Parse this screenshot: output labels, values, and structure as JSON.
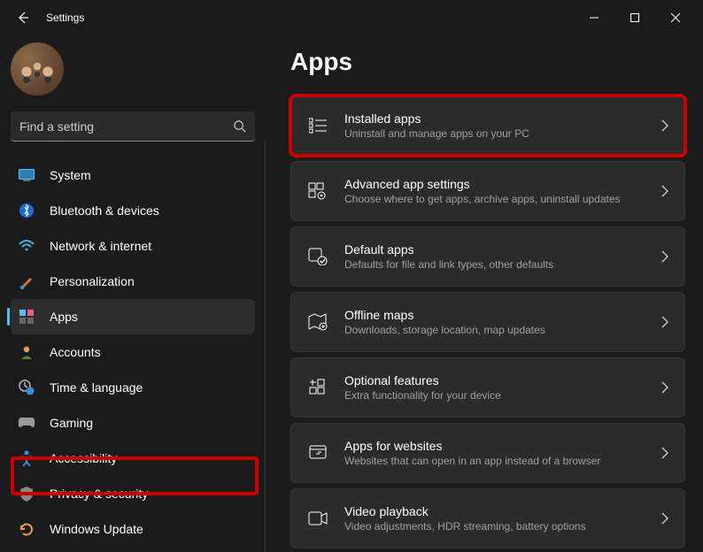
{
  "window": {
    "title": "Settings"
  },
  "search": {
    "placeholder": "Find a setting"
  },
  "sidebar": {
    "items": [
      {
        "label": "System"
      },
      {
        "label": "Bluetooth & devices"
      },
      {
        "label": "Network & internet"
      },
      {
        "label": "Personalization"
      },
      {
        "label": "Apps"
      },
      {
        "label": "Accounts"
      },
      {
        "label": "Time & language"
      },
      {
        "label": "Gaming"
      },
      {
        "label": "Accessibility"
      },
      {
        "label": "Privacy & security"
      },
      {
        "label": "Windows Update"
      }
    ]
  },
  "main": {
    "heading": "Apps",
    "cards": [
      {
        "title": "Installed apps",
        "sub": "Uninstall and manage apps on your PC"
      },
      {
        "title": "Advanced app settings",
        "sub": "Choose where to get apps, archive apps, uninstall updates"
      },
      {
        "title": "Default apps",
        "sub": "Defaults for file and link types, other defaults"
      },
      {
        "title": "Offline maps",
        "sub": "Downloads, storage location, map updates"
      },
      {
        "title": "Optional features",
        "sub": "Extra functionality for your device"
      },
      {
        "title": "Apps for websites",
        "sub": "Websites that can open in an app instead of a browser"
      },
      {
        "title": "Video playback",
        "sub": "Video adjustments, HDR streaming, battery options"
      }
    ]
  }
}
